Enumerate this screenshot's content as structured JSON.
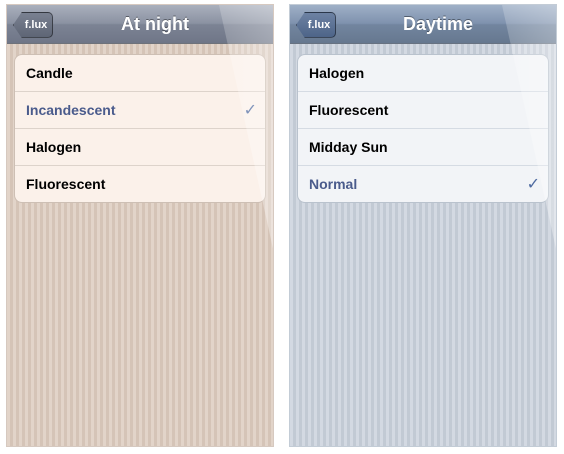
{
  "night": {
    "back_label": "f.lux",
    "title": "At night",
    "items": [
      {
        "label": "Candle",
        "selected": false
      },
      {
        "label": "Incandescent",
        "selected": true
      },
      {
        "label": "Halogen",
        "selected": false
      },
      {
        "label": "Fluorescent",
        "selected": false
      }
    ]
  },
  "day": {
    "back_label": "f.lux",
    "title": "Daytime",
    "items": [
      {
        "label": "Halogen",
        "selected": false
      },
      {
        "label": "Fluorescent",
        "selected": false
      },
      {
        "label": "Midday Sun",
        "selected": false
      },
      {
        "label": "Normal",
        "selected": true
      }
    ]
  },
  "icons": {
    "check": "checkmark-icon",
    "back": "back-chevron"
  },
  "colors": {
    "selected_text": "#4a5b8c",
    "checkmark": "#4e6aa0",
    "night_background": "#dccabd",
    "day_background": "#c8d0db"
  }
}
